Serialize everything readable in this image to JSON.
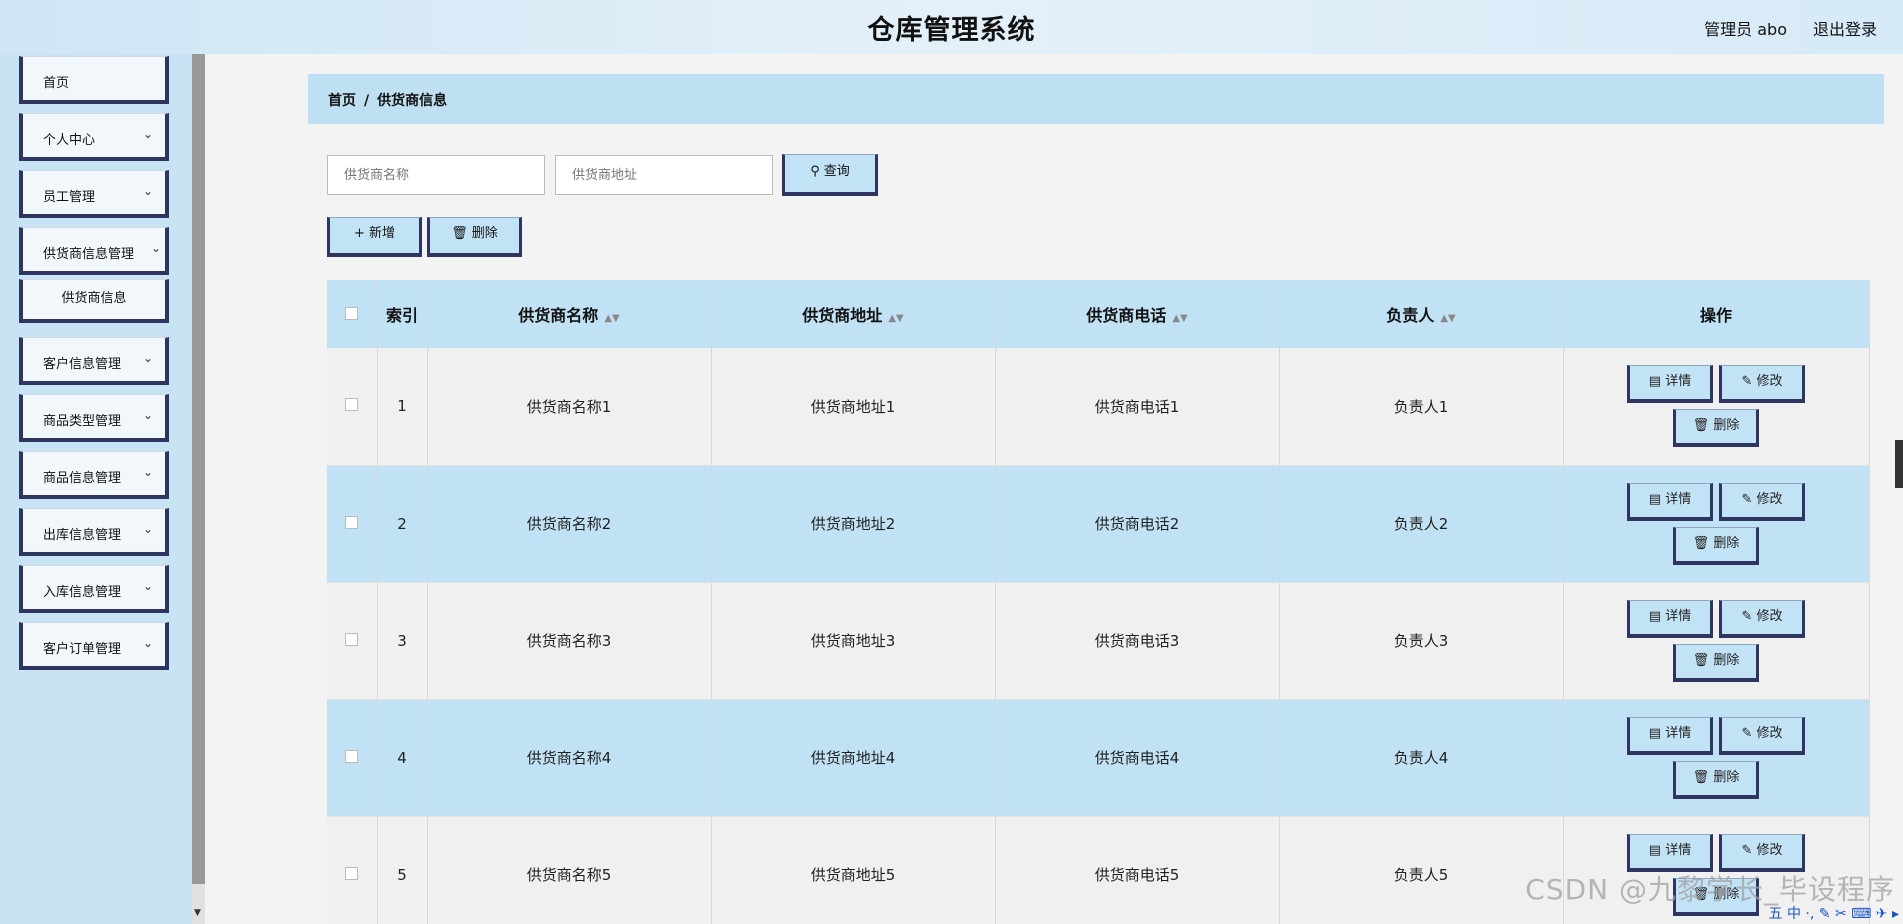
{
  "header": {
    "title": "仓库管理系统",
    "user": "管理员 abo",
    "logout": "退出登录"
  },
  "sidebar": {
    "items": [
      {
        "label": "首页",
        "chevron": ""
      },
      {
        "label": "个人中心",
        "chevron": "⌄"
      },
      {
        "label": "员工管理",
        "chevron": "⌄"
      },
      {
        "label": "供货商信息管理",
        "chevron": "⌄"
      },
      {
        "label": "供货商信息",
        "chevron": ""
      },
      {
        "label": "客户信息管理",
        "chevron": "⌄"
      },
      {
        "label": "商品类型管理",
        "chevron": "⌄"
      },
      {
        "label": "商品信息管理",
        "chevron": "⌄"
      },
      {
        "label": "出库信息管理",
        "chevron": "⌄"
      },
      {
        "label": "入库信息管理",
        "chevron": "⌄"
      },
      {
        "label": "客户订单管理",
        "chevron": "⌄"
      }
    ]
  },
  "breadcrumb": {
    "home": "首页",
    "separator": "/",
    "current": "供货商信息"
  },
  "search": {
    "name_placeholder": "供货商名称",
    "address_placeholder": "供货商地址",
    "query_label": "查询"
  },
  "toolbar": {
    "add_label": "新增",
    "delete_label": "删除"
  },
  "table": {
    "headers": {
      "index": "索引",
      "name": "供货商名称",
      "address": "供货商地址",
      "phone": "供货商电话",
      "contact": "负责人",
      "ops": "操作"
    },
    "rows": [
      {
        "index": "1",
        "name": "供货商名称1",
        "address": "供货商地址1",
        "phone": "供货商电话1",
        "contact": "负责人1"
      },
      {
        "index": "2",
        "name": "供货商名称2",
        "address": "供货商地址2",
        "phone": "供货商电话2",
        "contact": "负责人2"
      },
      {
        "index": "3",
        "name": "供货商名称3",
        "address": "供货商地址3",
        "phone": "供货商电话3",
        "contact": "负责人3"
      },
      {
        "index": "4",
        "name": "供货商名称4",
        "address": "供货商地址4",
        "phone": "供货商电话4",
        "contact": "负责人4"
      },
      {
        "index": "5",
        "name": "供货商名称5",
        "address": "供货商地址5",
        "phone": "供货商电话5",
        "contact": "负责人5"
      }
    ],
    "op_labels": {
      "detail": "详情",
      "edit": "修改",
      "delete": "删除"
    }
  },
  "watermark": "CSDN @九黎学长_毕设程序",
  "tray": "五 中 ·, ✎ ✂ ⌨ ✈ ▸",
  "icons": {
    "search": "search-icon",
    "plus": "plus-icon",
    "trash": "trash-icon",
    "doc": "document-icon",
    "pen": "pen-icon",
    "chevron": "chevron-down-icon"
  },
  "colors": {
    "accent": "#c1e2f4",
    "border": "#2f3561"
  }
}
